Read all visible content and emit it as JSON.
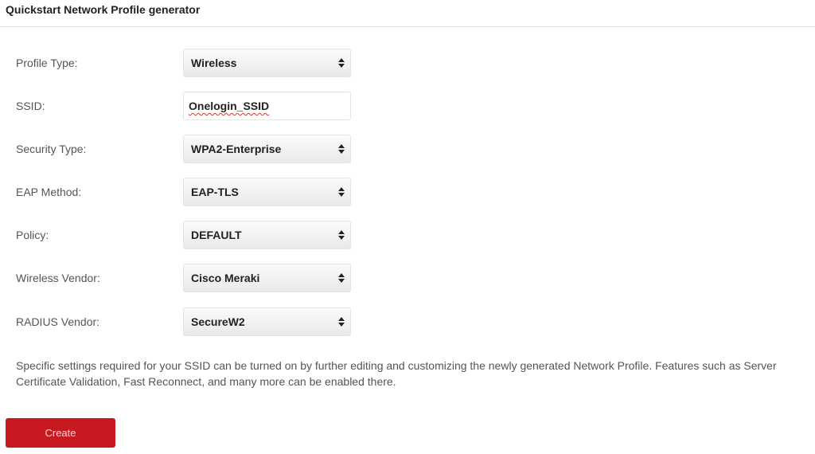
{
  "header": {
    "title": "Quickstart Network Profile generator"
  },
  "form": {
    "profile_type": {
      "label": "Profile Type:",
      "value": "Wireless"
    },
    "ssid": {
      "label": "SSID:",
      "value": "Onelogin_SSID"
    },
    "security_type": {
      "label": "Security Type:",
      "value": "WPA2-Enterprise"
    },
    "eap_method": {
      "label": "EAP Method:",
      "value": "EAP-TLS"
    },
    "policy": {
      "label": "Policy:",
      "value": "DEFAULT"
    },
    "wireless_vendor": {
      "label": "Wireless Vendor:",
      "value": "Cisco Meraki"
    },
    "radius_vendor": {
      "label": "RADIUS Vendor:",
      "value": "SecureW2"
    }
  },
  "info_text": "Specific settings required for your SSID can be turned on by further editing and customizing the newly generated Network Profile. Features such as Server Certificate Validation, Fast Reconnect, and many more can be enabled there.",
  "create_button": {
    "label": "Create"
  },
  "icons": {
    "select_arrow": "updown-arrows-icon"
  },
  "colors": {
    "accent": "#c91920",
    "spellcheck_underline": "#d43a3a"
  }
}
